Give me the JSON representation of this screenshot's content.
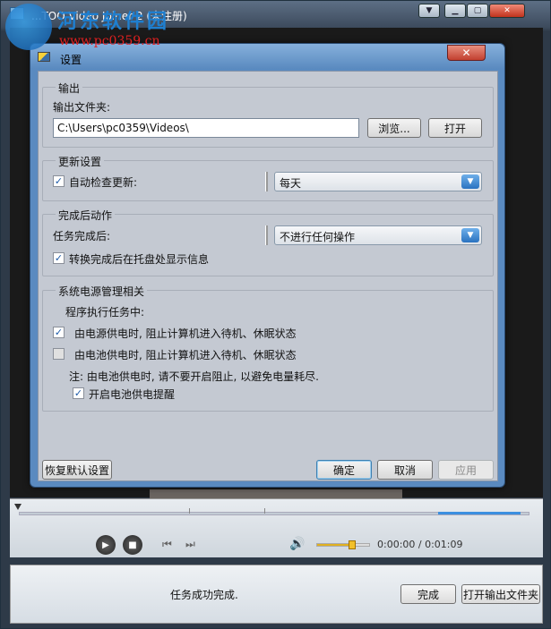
{
  "app": {
    "title": "...TOO Video Joiner 2 (未注册)"
  },
  "watermark": {
    "line1": "河东软件园",
    "line2": "www.pc0359.cn"
  },
  "dialog": {
    "title": "设置",
    "close_glyph": "✕",
    "output": {
      "group_label": "输出",
      "folder_label": "输出文件夹:",
      "folder_value": "C:\\Users\\pc0359\\Videos\\",
      "browse_label": "浏览...",
      "open_label": "打开"
    },
    "update": {
      "group_label": "更新设置",
      "auto_check_label": "自动检查更新:",
      "auto_check_checked": true,
      "frequency_value": "每天"
    },
    "completion": {
      "group_label": "完成后动作",
      "task_done_label": "任务完成后:",
      "action_value": "不进行任何操作",
      "tray_info_label": "转换完成后在托盘处显示信息",
      "tray_info_checked": true
    },
    "power": {
      "group_label": "系统电源管理相关",
      "during_task_label": "程序执行任务中:",
      "ac_label": "由电源供电时, 阻止计算机进入待机、休眠状态",
      "ac_checked": true,
      "battery_label": "由电池供电时, 阻止计算机进入待机、休眠状态",
      "battery_checked": false,
      "note": "注: 由电池供电时, 请不要开启阻止, 以避免电量耗尽.",
      "battery_reminder_label": "开启电池供电提醒",
      "battery_reminder_checked": true
    },
    "restore_defaults_label": "恢复默认设置",
    "ok_label": "确定",
    "cancel_label": "取消",
    "apply_label": "应用"
  },
  "player": {
    "time_text": "0:00:00 / 0:01:09",
    "volume_fraction": 0.65
  },
  "footer": {
    "status": "任务成功完成.",
    "done_label": "完成",
    "open_output_label": "打开输出文件夹"
  },
  "icons": [
    "app-icon",
    "minimize-icon",
    "maximize-icon",
    "close-icon",
    "play-icon",
    "stop-icon",
    "prev-icon",
    "next-icon",
    "volume-icon",
    "dropdown-arrow-icon",
    "checkbox-check-icon"
  ]
}
